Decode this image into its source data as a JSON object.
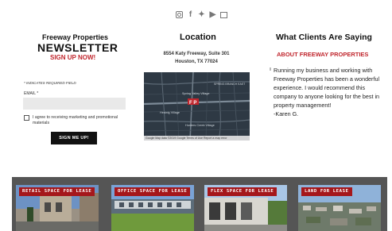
{
  "social": {
    "icons": [
      "instagram-icon",
      "facebook-icon",
      "twitter-icon",
      "youtube-icon",
      "email-icon"
    ],
    "fb_glyph": "f",
    "tw_glyph": "✦",
    "yt_glyph": "▶"
  },
  "newsletter": {
    "brand": "Freeway Properties",
    "title": "NEWSLETTER",
    "subtitle": "SIGN UP NOW!",
    "required_note": "* INDICATES REQUIRED FIELD",
    "email_label": "EMAIL *",
    "email_value": "",
    "consent_text": "I agree to receiving marketing and promotional materials",
    "button_label": "SIGN ME UP!"
  },
  "location": {
    "title": "Location",
    "address_line1": "8554 Katy Freeway, Suite 301",
    "address_line2": "Houston, TX 77024",
    "map_labels": [
      "SPRING BRANCH EAST",
      "Spring Valley Village",
      "Hedwig Village",
      "Hunters Creek Village"
    ],
    "map_attribution": "Google  Map data ©2019 Google  Terms of Use  Report a map error"
  },
  "testimonials": {
    "title": "What Clients Are Saying",
    "about_link": "ABOUT FREEWAY PROPERTIES",
    "quote": "Running my business and working with Freeway Properties has been a wonderful experience. I would recommend this company to anyone looking for the best in property management!",
    "author": "-Karen G."
  },
  "listings": [
    {
      "label": "RETAIL SPACE FOR LEASE"
    },
    {
      "label": "OFFICE SPACE FOR LEASE"
    },
    {
      "label": "FLEX SPACE FOR LEASE"
    },
    {
      "label": "LAND FOR LEASE"
    }
  ],
  "colors": {
    "accent_red": "#c0262d",
    "banner_red": "#a5171b",
    "banner_band": "#555555",
    "button_dark": "#111111"
  }
}
